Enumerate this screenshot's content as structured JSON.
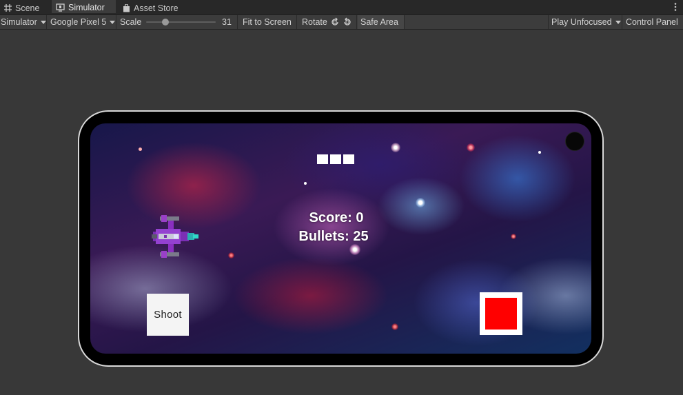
{
  "tabs": [
    {
      "label": "Scene",
      "icon": "grid-icon",
      "active": false
    },
    {
      "label": "Simulator",
      "icon": "device-icon",
      "active": true
    },
    {
      "label": "Asset Store",
      "icon": "bag-icon",
      "active": false
    }
  ],
  "toolbar": {
    "mode_dropdown": "Simulator",
    "device_dropdown": "Google Pixel 5",
    "scale_label": "Scale",
    "scale_value": "31",
    "fit_to_screen": "Fit to Screen",
    "rotate_label": "Rotate",
    "safe_area": "Safe Area",
    "play_mode_dropdown": "Play Unfocused",
    "control_panel": "Control Panel"
  },
  "game": {
    "lives_count": 3,
    "score_text": "Score: 0",
    "bullets_text": "Bullets: 25",
    "shoot_label": "Shoot",
    "red_button_color": "#ff0000"
  },
  "colors": {
    "editor_bg": "#383838",
    "toolbar_bg": "#3c3c3c",
    "tabbar_bg": "#282828"
  }
}
